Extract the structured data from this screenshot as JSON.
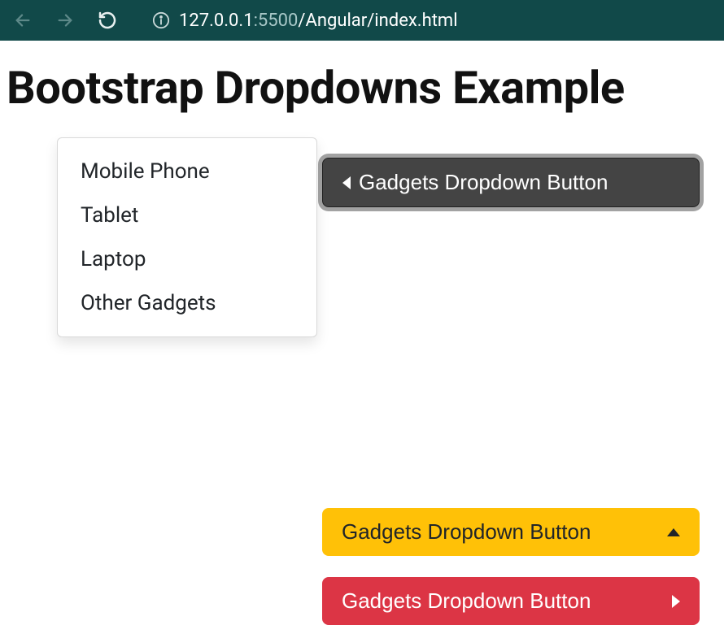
{
  "browser": {
    "url_host": "127.0.0.1",
    "url_port": ":5500",
    "url_path": "/Angular/index.html"
  },
  "page": {
    "title": "Bootstrap Dropdowns Example"
  },
  "dropdown": {
    "items": [
      "Mobile Phone",
      "Tablet",
      "Laptop",
      "Other Gadgets"
    ]
  },
  "buttons": {
    "dark_label": "Gadgets Dropdown Button",
    "warning_label": "Gadgets Dropdown Button",
    "danger_label": "Gadgets Dropdown Button"
  }
}
